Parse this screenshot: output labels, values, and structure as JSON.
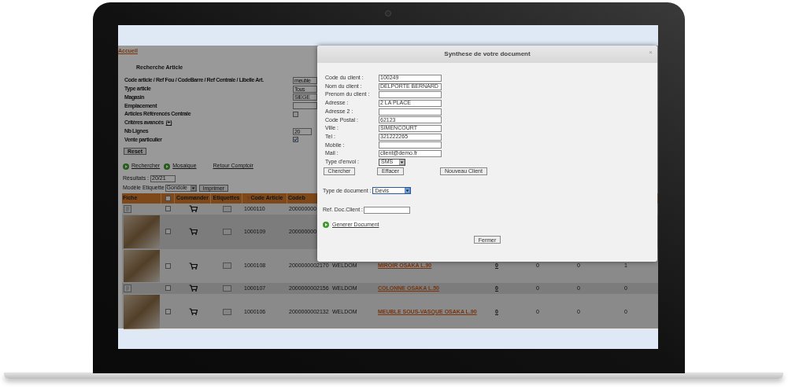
{
  "breadcrumb": "Accueil",
  "search": {
    "title": "Recherche Article",
    "fields": [
      {
        "kind": "text",
        "label": "Code article / Ref Fou / CodeBarre / Ref Centrale / Libelle Art.",
        "value": "meuble"
      },
      {
        "kind": "select",
        "label": "Type article",
        "value": "Tous"
      },
      {
        "kind": "select",
        "label": "Magasin",
        "value": "SIEGE"
      },
      {
        "kind": "text",
        "label": "Emplacement"
      },
      {
        "kind": "checkbox",
        "label": "Articles Référencés Centrale",
        "checked": false
      },
      {
        "kind": "link",
        "label": "Critères avancés",
        "link": "(+)"
      },
      {
        "kind": "number",
        "label": "Nb Lignes",
        "value": "20"
      },
      {
        "kind": "checkbox",
        "label": "Vente particulier",
        "checked": true
      }
    ],
    "reset_button": "Reset"
  },
  "actions": [
    {
      "kind": "icon_link",
      "label": "Rechercher"
    },
    {
      "kind": "icon_link",
      "label": "Mosaique"
    },
    {
      "kind": "link",
      "label": "Retour Comptoir"
    }
  ],
  "results": {
    "label": "Résultats :",
    "value": "20/21"
  },
  "label_model": {
    "label": "Modèle Etiquette",
    "value": "Gondole",
    "button": "Imprimer"
  },
  "table": {
    "columns": [
      {
        "kind": "text",
        "label": "Fiche"
      },
      {
        "kind": "checkbox",
        "checked": false
      },
      {
        "kind": "text",
        "label": "Commander"
      },
      {
        "kind": "text",
        "label": "Etiquettes"
      },
      {
        "kind": "sort",
        "label": "Code Article"
      },
      {
        "kind": "text",
        "label": "Codeb"
      }
    ],
    "rows": [
      {
        "fiche": {
          "kind": "icon"
        },
        "checked": false,
        "code": "1000110",
        "codebarre": "200000000"
      },
      {
        "fiche": {
          "kind": "photo"
        },
        "checked": false,
        "code": "1000109",
        "codebarre": "200000000"
      },
      {
        "fiche": {
          "kind": "photo"
        },
        "checked": false,
        "code": "1000108",
        "codebarre": "2000000002170",
        "fournisseur": "WELDOM",
        "libelle": "MIROIR OSAKA L.90",
        "column_9": "0",
        "column_10": "0",
        "column_11": "0",
        "column_12": "1"
      },
      {
        "fiche": {
          "kind": "icon"
        },
        "checked": false,
        "code": "1000107",
        "codebarre": "2000000002156",
        "fournisseur": "WELDOM",
        "libelle": "COLONNE OSAKA L.50",
        "column_9": "0",
        "column_10": "0",
        "column_11": "0",
        "column_12": "0"
      },
      {
        "fiche": {
          "kind": "photo"
        },
        "checked": false,
        "code": "1000106",
        "codebarre": "2000000002132",
        "fournisseur": "WELDOM",
        "libelle": "MEUBLE SOUS-VASQUE OSAKA L.90",
        "column_9": "0",
        "column_10": "0",
        "column_11": "0",
        "column_12": "0"
      }
    ]
  },
  "dialog": {
    "title": "Synthese de votre document",
    "close": "×",
    "client_fields": [
      {
        "kind": "text",
        "label": "Code du client :",
        "value": "100249"
      },
      {
        "kind": "text",
        "label": "Nom du client :",
        "value": "DELPORTE BERNARD"
      },
      {
        "kind": "text",
        "label": "Prenom du client :"
      },
      {
        "kind": "text",
        "label": "Adresse :",
        "value": "2 LA PLACE"
      },
      {
        "kind": "text",
        "label": "Adresse 2 :"
      },
      {
        "kind": "text",
        "label": "Code Postal :",
        "value": "62123"
      },
      {
        "kind": "text",
        "label": "Ville :",
        "value": "SIMENCOURT"
      },
      {
        "kind": "text",
        "label": "Tel :",
        "value": "321222265"
      },
      {
        "kind": "text",
        "label": "Mobile :"
      },
      {
        "kind": "text",
        "label": "Mail :",
        "value": "client@demo.fr"
      },
      {
        "kind": "select",
        "label": "Type d'envoi :",
        "value": "SMS"
      }
    ],
    "client_buttons": [
      "Chercher",
      "Effacer",
      "Nouveau Client"
    ],
    "document_type": {
      "label": "Type de document :",
      "value": "Devis"
    },
    "client_ref": {
      "label": "Ref. Doc.Client :"
    },
    "generate_link": "Generer Document",
    "close_button": "Fermer"
  }
}
